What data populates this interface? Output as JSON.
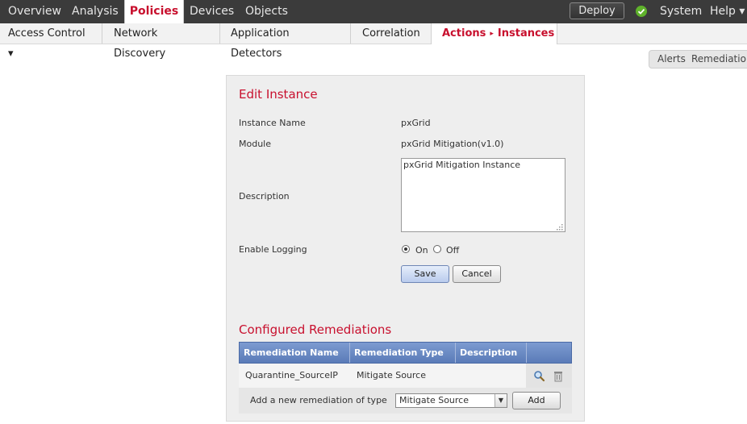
{
  "topnav": {
    "tabs": [
      {
        "label": "Overview"
      },
      {
        "label": "Analysis"
      },
      {
        "label": "Policies"
      },
      {
        "label": "Devices"
      },
      {
        "label": "Objects"
      }
    ],
    "deploy_label": "Deploy",
    "system_label": "System",
    "help_label": "Help ▾",
    "status_icon": "check-circle-icon",
    "colors": {
      "bar": "#3b3b3b",
      "accent": "#c8102e",
      "ok": "#5fb22b"
    }
  },
  "subnav": {
    "items": [
      {
        "label": "Access Control ▾"
      },
      {
        "label": "Network Discovery"
      },
      {
        "label": "Application Detectors"
      },
      {
        "label": "Correlation"
      }
    ],
    "active": {
      "part1": "Actions",
      "part2": "Instances",
      "separator": "▸"
    }
  },
  "side_tabs": {
    "alerts": "Alerts",
    "remediations": "Remediations"
  },
  "edit_instance": {
    "title": "Edit Instance",
    "fields": {
      "instance_name_label": "Instance Name",
      "instance_name_value": "pxGrid",
      "module_label": "Module",
      "module_value": "pxGrid Mitigation(v1.0)",
      "description_label": "Description",
      "description_value": "pxGrid Mitigation Instance",
      "logging_label": "Enable Logging",
      "logging_on": "On",
      "logging_off": "Off",
      "logging_selected": "On"
    },
    "save_label": "Save",
    "cancel_label": "Cancel"
  },
  "remediations": {
    "title": "Configured Remediations",
    "columns": [
      "Remediation Name",
      "Remediation Type",
      "Description"
    ],
    "rows": [
      {
        "name": "Quarantine_SourceIP",
        "type": "Mitigate Source",
        "description": ""
      }
    ],
    "add_prompt": "Add a new remediation of type",
    "add_type_selected": "Mitigate Source",
    "add_label": "Add",
    "row_icons": [
      "search-icon",
      "trash-icon"
    ]
  }
}
